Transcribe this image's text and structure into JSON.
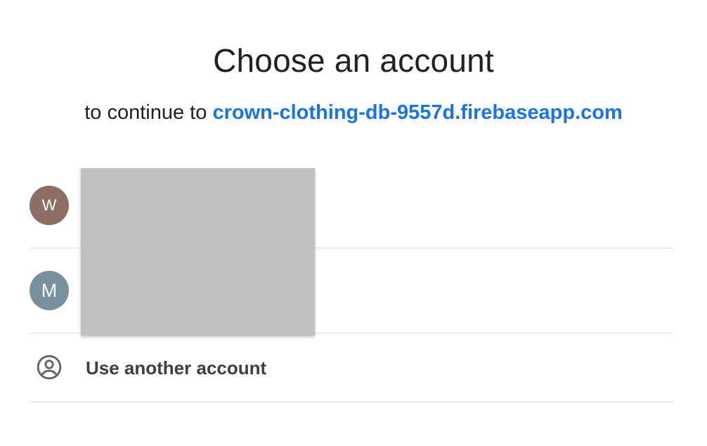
{
  "header": {
    "title": "Choose an account",
    "subtitle_prefix": "to continue to",
    "app_link": "crown-clothing-db-9557d.firebaseapp.com"
  },
  "accounts": [
    {
      "initial": "W",
      "avatar_color": "#8d6e63"
    },
    {
      "initial": "M",
      "avatar_color": "#78909c"
    }
  ],
  "other_account": {
    "label": "Use another account",
    "icon": "account-circle-icon"
  },
  "colors": {
    "link": "#1a73e8",
    "divider": "#dadce0",
    "redaction": "#c0c0c0"
  }
}
